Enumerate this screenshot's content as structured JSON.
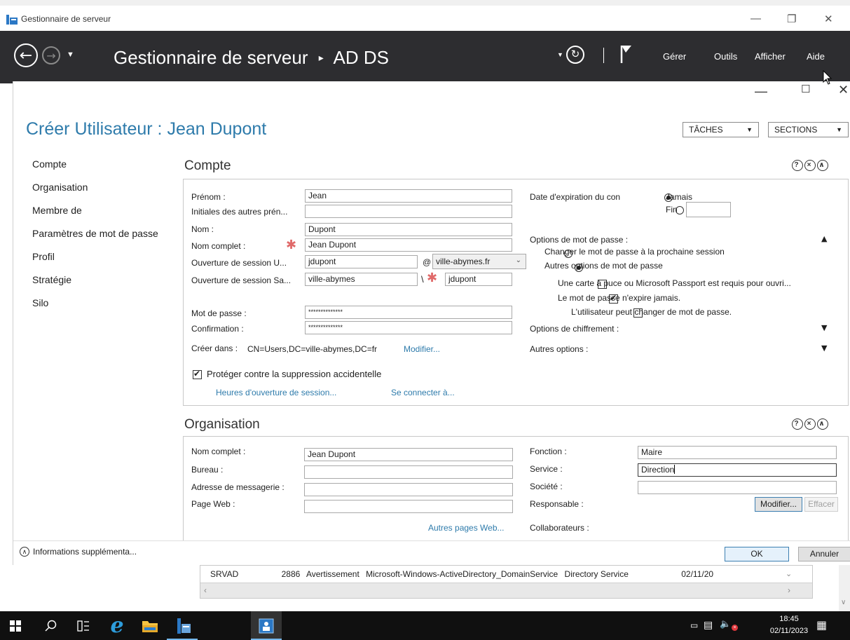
{
  "window": {
    "title": "Gestionnaire de serveur"
  },
  "header": {
    "title": "Gestionnaire de serveur",
    "separator": "▸",
    "location": "AD DS",
    "menu": [
      "Gérer",
      "Outils",
      "Afficher",
      "Aide"
    ]
  },
  "dialog": {
    "title": "Créer Utilisateur : Jean Dupont",
    "tasks_label": "TÂCHES",
    "sections_label": "SECTIONS",
    "nav": [
      "Compte",
      "Organisation",
      "Membre de",
      "Paramètres de mot de passe",
      "Profil",
      "Stratégie",
      "Silo"
    ],
    "account": {
      "title": "Compte",
      "first_name_label": "Prénom :",
      "first_name": "Jean",
      "initials_label": "Initiales des autres prén...",
      "initials": "",
      "last_name_label": "Nom :",
      "last_name": "Dupont",
      "full_name_label": "Nom complet :",
      "full_name": "Jean Dupont",
      "upn_label": "Ouverture de session U...",
      "upn": "jdupont",
      "at": "@",
      "domain": "ville-abymes.fr",
      "sam_label": "Ouverture de session Sa...",
      "sam_domain": "ville-abymes",
      "backslash": "\\",
      "sam": "jdupont",
      "password_label": "Mot de passe :",
      "password": "**************",
      "confirm_label": "Confirmation :",
      "confirm": "**************",
      "create_in_label": "Créer dans :",
      "create_in": "CN=Users,DC=ville-abymes,DC=fr",
      "modify_link": "Modifier...",
      "protect_label": "Protéger contre la suppression accidentelle",
      "logon_hours_link": "Heures d'ouverture de session...",
      "logon_to_link": "Se connecter à...",
      "expiry_label": "Date d'expiration du con",
      "expiry_never": "Jamais",
      "expiry_end": "Fin",
      "pwd_options_label": "Options de mot de passe :",
      "opt_change_next": "Changer le mot de passe à la prochaine session",
      "opt_other": "Autres options de mot de passe",
      "opt_smartcard": "Une carte à puce ou Microsoft Passport est requis pour ouvri...",
      "opt_never_expires": "Le mot de passe n'expire jamais.",
      "opt_user_can_change": "L'utilisateur peut changer de mot de passe.",
      "encryption_label": "Options de chiffrement :",
      "other_options_label": "Autres options :"
    },
    "organization": {
      "title": "Organisation",
      "full_name_label": "Nom complet :",
      "full_name": "Jean Dupont",
      "office_label": "Bureau :",
      "office": "",
      "email_label": "Adresse de messagerie :",
      "email": "",
      "web_label": "Page Web :",
      "web": "",
      "more_web_link": "Autres pages Web...",
      "job_label": "Fonction :",
      "job": "Maire",
      "dept_label": "Service :",
      "dept": "Direction",
      "company_label": "Société :",
      "company": "",
      "manager_label": "Responsable :",
      "modify_btn": "Modifier...",
      "clear_btn": "Effacer",
      "reports_label": "Collaborateurs :"
    },
    "more_info": "Informations supplémenta...",
    "ok": "OK",
    "cancel": "Annuler"
  },
  "events": {
    "server": "SRVAD",
    "id": "2886",
    "level": "Avertissement",
    "source": "Microsoft-Windows-ActiveDirectory_DomainService",
    "log": "Directory Service",
    "date": "02/11/20"
  },
  "taskbar": {
    "time": "18:45",
    "date": "02/11/2023"
  },
  "colors": {
    "accent": "#2e7bab",
    "header_bg": "#2d2d30",
    "required": "#e06a6a"
  }
}
